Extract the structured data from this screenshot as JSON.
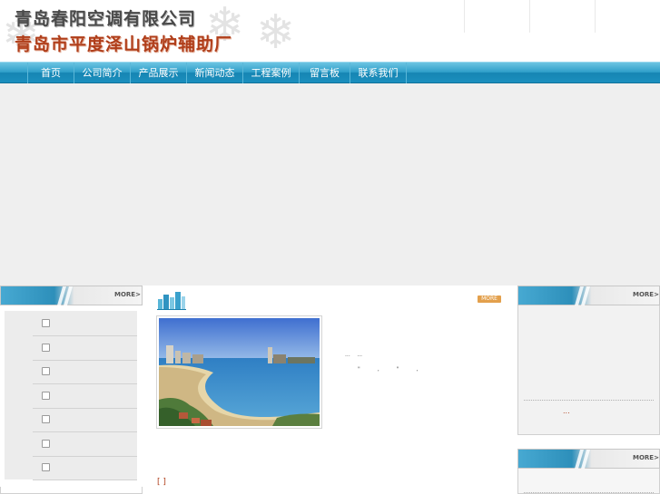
{
  "header": {
    "company_name_1": "青岛春阳空调有限公司",
    "company_name_2": "青岛市平度泽山锅炉辅助厂"
  },
  "nav": {
    "items": [
      {
        "label": "首页"
      },
      {
        "label": "公司简介"
      },
      {
        "label": "产品展示"
      },
      {
        "label": "新闻动态"
      },
      {
        "label": "工程案例"
      },
      {
        "label": "留言板"
      },
      {
        "label": "联系我们"
      }
    ]
  },
  "left_panel": {
    "more_label": "MORE>",
    "item_count": 7
  },
  "center_panel": {
    "more_label": "MORE",
    "about_line_1": "...    ...",
    "about_line_2": "\"          ,          \"          ,",
    "more_link": "[    ]"
  },
  "right_panel": {
    "box1_more_label": "MORE>",
    "box2_more_label": "MORE>",
    "news_dots": "..."
  },
  "colors": {
    "nav_blue": "#1b8fbe",
    "brand_red": "#b03e1a",
    "more_orange": "#e3a04c"
  }
}
